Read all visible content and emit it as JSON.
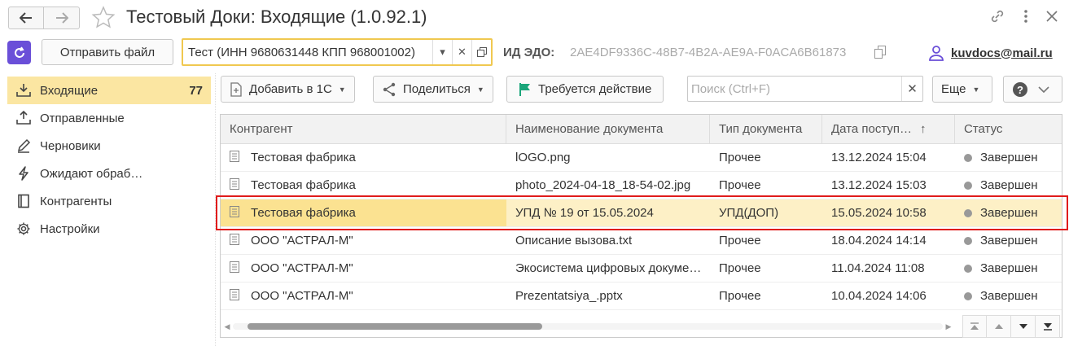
{
  "window": {
    "title": "Тестовый Доки: Входящие (1.0.92.1)"
  },
  "header": {
    "send_file_label": "Отправить файл",
    "organization_value": "Тест (ИНН 9680631448 КПП 968001002)",
    "edo_label": "ИД ЭДО:",
    "edo_value": "2AE4DF9336C-48B7-4B2A-AE9A-F0ACA6B61873",
    "user_email": "kuvdocs@mail.ru"
  },
  "sidebar": {
    "items": [
      {
        "label": "Входящие",
        "count": "77",
        "icon": "inbox-download-icon",
        "active": true
      },
      {
        "label": "Отправленные",
        "icon": "outbox-upload-icon"
      },
      {
        "label": "Черновики",
        "icon": "pencil-icon"
      },
      {
        "label": "Ожидают обраб…",
        "icon": "lightning-icon"
      },
      {
        "label": "Контрагенты",
        "icon": "contacts-book-icon"
      },
      {
        "label": "Настройки",
        "icon": "gear-icon"
      }
    ]
  },
  "toolbar": {
    "add_label": "Добавить в 1С",
    "share_label": "Поделиться",
    "action_label": "Требуется действие",
    "search_placeholder": "Поиск (Ctrl+F)",
    "more_label": "Еще"
  },
  "table": {
    "columns": [
      "Контрагент",
      "Наименование документа",
      "Тип документа",
      "Дата поступ…",
      "Статус"
    ],
    "rows": [
      {
        "counterparty": "Тестовая фабрика",
        "name": "lOGO.png",
        "type": "Прочее",
        "date": "13.12.2024 15:04",
        "status": "Завершен"
      },
      {
        "counterparty": "Тестовая фабрика",
        "name": "photo_2024-04-18_18-54-02.jpg",
        "type": "Прочее",
        "date": "13.12.2024 15:03",
        "status": "Завершен"
      },
      {
        "counterparty": "Тестовая фабрика",
        "name": "УПД № 19 от 15.05.2024",
        "type": "УПД(ДОП)",
        "date": "15.05.2024 10:58",
        "status": "Завершен",
        "selected": true
      },
      {
        "counterparty": "ООО \"АСТРАЛ-М\"",
        "name": "Описание вызова.txt",
        "type": "Прочее",
        "date": "18.04.2024 14:14",
        "status": "Завершен"
      },
      {
        "counterparty": "ООО \"АСТРАЛ-М\"",
        "name": "Экосистема цифровых документов",
        "type": "Прочее",
        "date": "11.04.2024 11:08",
        "status": "Завершен"
      },
      {
        "counterparty": "ООО \"АСТРАЛ-М\"",
        "name": "Prezentatsiya_.pptx",
        "type": "Прочее",
        "date": "10.04.2024 14:06",
        "status": "Завершен"
      }
    ]
  },
  "colors": {
    "active_nav": "#fbe6a2",
    "selected_row": "#fdf0c6",
    "highlight_border": "#e01b1b",
    "field_focus": "#f0c850",
    "app_icon": "#6a4fd8",
    "flag": "#1aa67a"
  }
}
